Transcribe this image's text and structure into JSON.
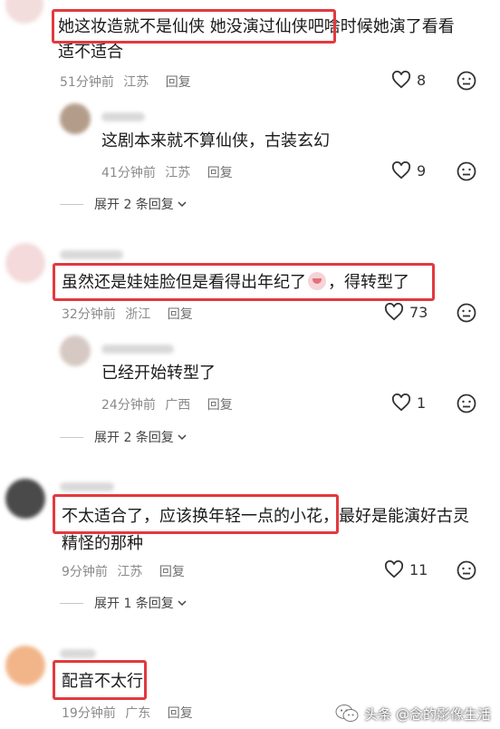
{
  "comments": [
    {
      "text_boxed": "她这妆造就不是仙侠 她没演过仙侠吧",
      "text_rest_line1": "啥时候她演了看看",
      "text_line2": "适不适合",
      "time": "51分钟前",
      "location": "江苏",
      "reply_label": "回复",
      "likes": "8",
      "reply": {
        "text": "这剧本来就不算仙侠，古装玄幻",
        "time": "41分钟前",
        "location": "江苏",
        "reply_label": "回复",
        "likes": "9"
      },
      "expand_label": "展开 2 条回复"
    },
    {
      "text_boxed_a": "虽然还是娃娃脸但是看得出年纪了",
      "text_boxed_b": "，得转型了",
      "time": "32分钟前",
      "location": "浙江",
      "reply_label": "回复",
      "likes": "73",
      "reply": {
        "text": "已经开始转型了",
        "time": "24分钟前",
        "location": "广西",
        "reply_label": "回复",
        "likes": "1"
      },
      "expand_label": "展开 2 条回复"
    },
    {
      "text_boxed": "不太适合了，应该换年轻一点的小花",
      "text_rest_line1": "，最好是能演好古灵",
      "text_line2": "精怪的那种",
      "time": "9分钟前",
      "location": "江苏",
      "reply_label": "回复",
      "likes": "11",
      "expand_label": "展开 1 条回复"
    },
    {
      "text_boxed": "配音不太行",
      "time": "19分钟前",
      "location": "广东",
      "reply_label": "回复"
    }
  ],
  "watermark": {
    "label": "头条 @念的影像生活"
  },
  "colors": {
    "highlight": "#e2393f",
    "meta": "#8a8a8a"
  }
}
